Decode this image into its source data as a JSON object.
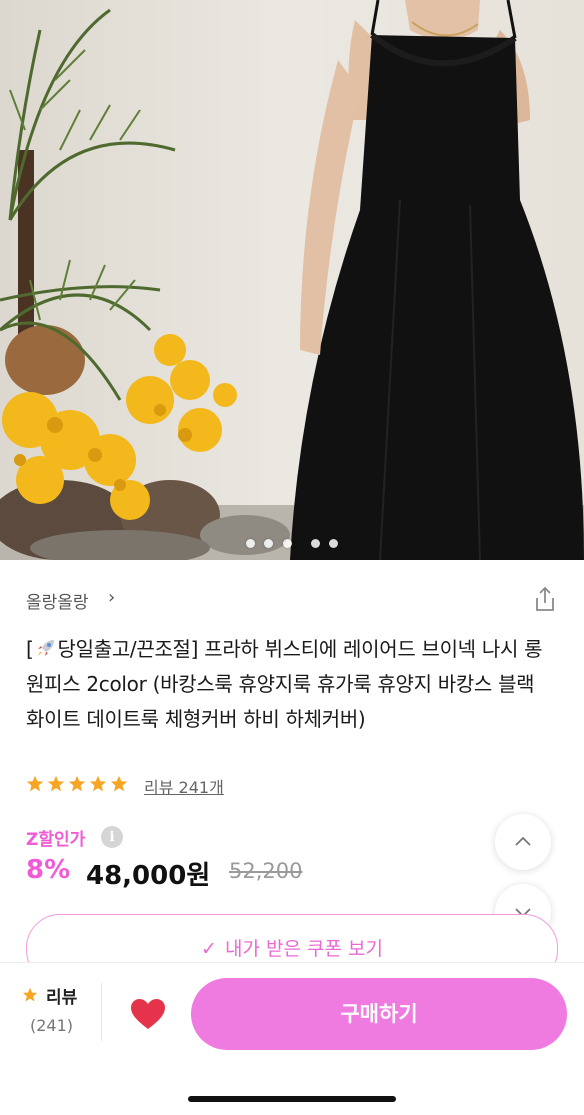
{
  "gallery": {
    "slides": [
      "slide-1",
      "slide-2",
      "slide-3",
      "slide-4",
      "slide-5"
    ]
  },
  "shop": {
    "name": "올랑올랑",
    "chevron": "›"
  },
  "product": {
    "title_prefix": "[",
    "title_rest": "당일출고/끈조절] 프라하 뷔스티에 레이어드 브이넥 나시 롱원피스 2color (바캉스룩 휴양지룩 휴가룩 휴양지 바캉스 블랙 화이트 데이트룩 체형커버 하비 하체커버)"
  },
  "rating": {
    "stars": 5,
    "review_link": "리뷰 241개"
  },
  "pricing": {
    "label": "Z할인가",
    "info_glyph": "i",
    "discount": "8%",
    "price": "48,000원",
    "original": "52,200"
  },
  "coupon": {
    "check_glyph": "✓",
    "label": "내가 받은 쿠폰 보기"
  },
  "bottom_bar": {
    "review_label": "리뷰",
    "review_count": "(241)",
    "buy_label": "구매하기"
  },
  "colors": {
    "accent_pink": "#f05bd6",
    "buy_button": "#f07be0",
    "star": "#f6a623",
    "heart": "#e5334b"
  },
  "icons": {
    "share": "share-icon",
    "heart": "heart-icon",
    "scroll_up": "chevron-up-icon",
    "scroll_down": "chevron-down-icon"
  }
}
